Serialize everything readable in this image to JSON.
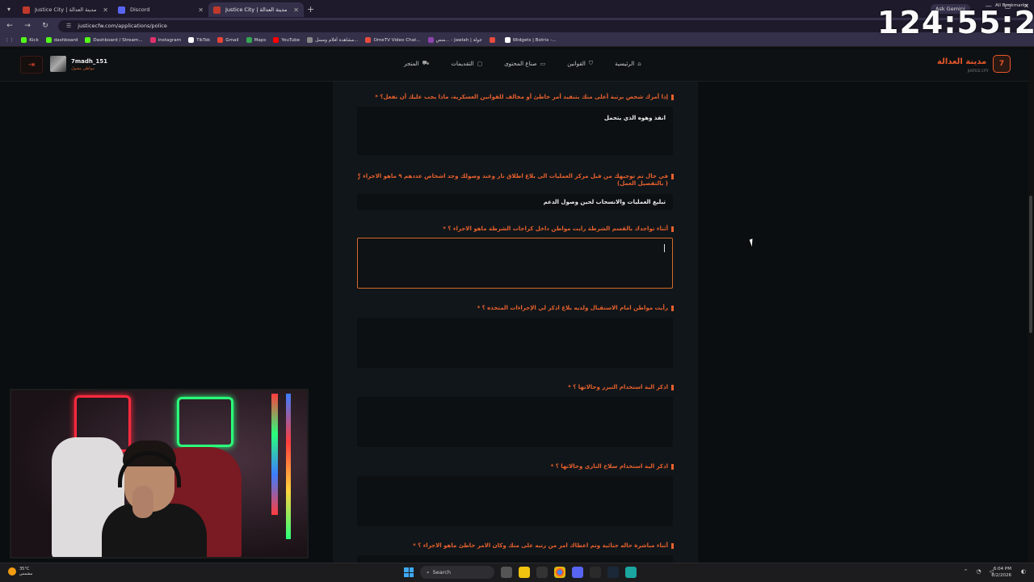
{
  "browser": {
    "tabs": [
      {
        "label": "Justice City | مدينة العدالة",
        "active": false,
        "color": "#c0392b"
      },
      {
        "label": "Discord",
        "active": false,
        "color": "#5865f2"
      },
      {
        "label": "Justice City | مدينة العدالة",
        "active": true,
        "color": "#c0392b"
      }
    ],
    "url": "justicecfw.com/applications/police",
    "bookmarks": [
      {
        "label": "Kick",
        "color": "#53fc18"
      },
      {
        "label": "dashboard",
        "color": "#53fc18"
      },
      {
        "label": "Dashboard / Stream...",
        "color": "#53fc18"
      },
      {
        "label": "instagram",
        "color": "#e1306c"
      },
      {
        "label": "TikTok",
        "color": "#ffffff"
      },
      {
        "label": "Gmail",
        "color": "#ea4335"
      },
      {
        "label": "Maps",
        "color": "#34a853"
      },
      {
        "label": "YouTube",
        "color": "#ff0000"
      },
      {
        "label": "مشاهدة أفلام ومسل...",
        "color": "#888888"
      },
      {
        "label": "OmeTV Video Chat...",
        "color": "#e74c3c"
      },
      {
        "label": "منص... - Jawlah | جولة",
        "color": "#8e44ad"
      },
      {
        "label": "",
        "color": "#e74c3c"
      },
      {
        "label": "Widgets | Botrix -...",
        "color": "#ffffff"
      }
    ],
    "all_bookmarks": "All Bookmarks",
    "ask_gemini": "Ask Gemini"
  },
  "site": {
    "logout_icon": "logout-icon",
    "username": "7madh_151",
    "user_role": "مواطن مقبول",
    "nav": [
      {
        "label": "الرئيسية",
        "icon": "⌂"
      },
      {
        "label": "القوانين",
        "icon": "⛉"
      },
      {
        "label": "صناع المحتوى",
        "icon": "▭"
      },
      {
        "label": "التقديمات",
        "icon": "▢"
      },
      {
        "label": "المتجر",
        "icon": "⛟"
      }
    ],
    "brand_title": "مدينة العدالة",
    "brand_sub": "JUSTICE CITY",
    "accent": "#e8612d"
  },
  "form": {
    "questions": [
      {
        "label": "إذا أمرك شخص برتبة أعلى منك بتنفيذ أمر خاطئ أو مخالف للقوانين العسكرية، ماذا يجب عليك أن تفعل؟ *",
        "answer": "انفذ وهوه الذي يتحمل"
      },
      {
        "label": "في حال تم توجيهك من قبل مركز العمليات الى بلاغ اطلاق نار وعند وصولك وجد اشخاص عددهم ٩ ماهو الاجراء ؟ ( بالتفصيل العمل)",
        "answer": "تبليغ العمليات والانسحاب لحين وصول الدعم"
      },
      {
        "label": "أثناء تواجدك بالقسم الشرطة رايت مواطن داخل كراجات الشرطة ماهو الاجراء ؟ *",
        "answer": ""
      },
      {
        "label": "رأيت مواطن امام الاستقبال ولديه بلاغ اذكر لي الإجراءات المتخذه ؟ *",
        "answer": ""
      },
      {
        "label": "اذكر الية استخدام التيزر وحالاتها ؟ *",
        "answer": ""
      },
      {
        "label": "اذكر الية استخدام سلاح الناري وحالاتها ؟ *",
        "answer": ""
      },
      {
        "label": "أثناء مباشرة حاله جنائية وتم اعطاك امر من رتبه على منك وكان الامر خاطئ ماهو الاجراء ؟ *",
        "answer": ""
      }
    ]
  },
  "overlay": {
    "clock": "124:55:25"
  },
  "taskbar": {
    "weather_temp": "35°C",
    "weather_desc": "مشمس",
    "search": "Search",
    "time": "6:04 PM",
    "date": "8/2/2026"
  }
}
